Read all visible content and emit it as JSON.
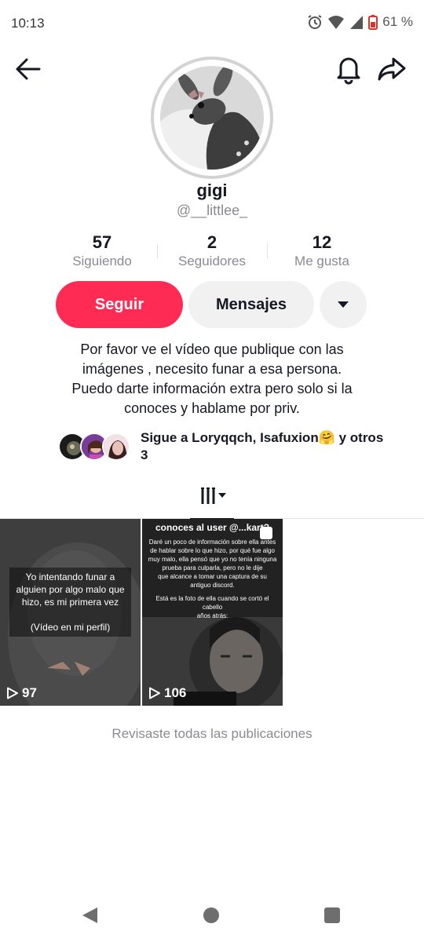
{
  "status_bar": {
    "time": "10:13",
    "battery": "61 %"
  },
  "profile": {
    "display_name": "gigi",
    "username": "@__littlee_"
  },
  "stats": [
    {
      "value": "57",
      "label": "Siguiendo"
    },
    {
      "value": "2",
      "label": "Seguidores"
    },
    {
      "value": "12",
      "label": "Me gusta"
    }
  ],
  "actions": {
    "follow_label": "Seguir",
    "message_label": "Mensajes",
    "more_icon": "triangle-down-icon"
  },
  "bio": "Por favor ve el vídeo que publique con las\nimágenes , necesito funar a esa persona.\nPuedo darte información extra pero solo si la\nconoces y hablame por priv.",
  "followed_by": {
    "text": "Sigue a Loryqqch, Isafuxion🤗 y otros 3"
  },
  "tabs": {
    "videos_icon": "grid-videos-icon"
  },
  "videos": [
    {
      "caption": "Yo intentando funar a\nalguien por algo malo que\nhizo, es mi primera vez\n\n(Vídeo en mi perfil)",
      "views": "97"
    },
    {
      "title": "conoces al user @...kart?",
      "body": "Daré un poco de información sobre ella antes\nde hablar sobre lo que hizo, por qué fue algo\nmuy malo, ella pensó que yo no tenía ninguna\nprueba para culparla, pero no le dije\nque alcance a tomar una captura de su\nantiguo discord.",
      "note": "Está es la foto de ella cuando se cortó el cabello\naños atrás:",
      "views": "106"
    }
  ],
  "end_text": "Revisaste todas las publicaciones",
  "colors": {
    "accent": "#fe2c55",
    "muted": "#8a8b91",
    "button_bg": "#f1f1f2"
  }
}
